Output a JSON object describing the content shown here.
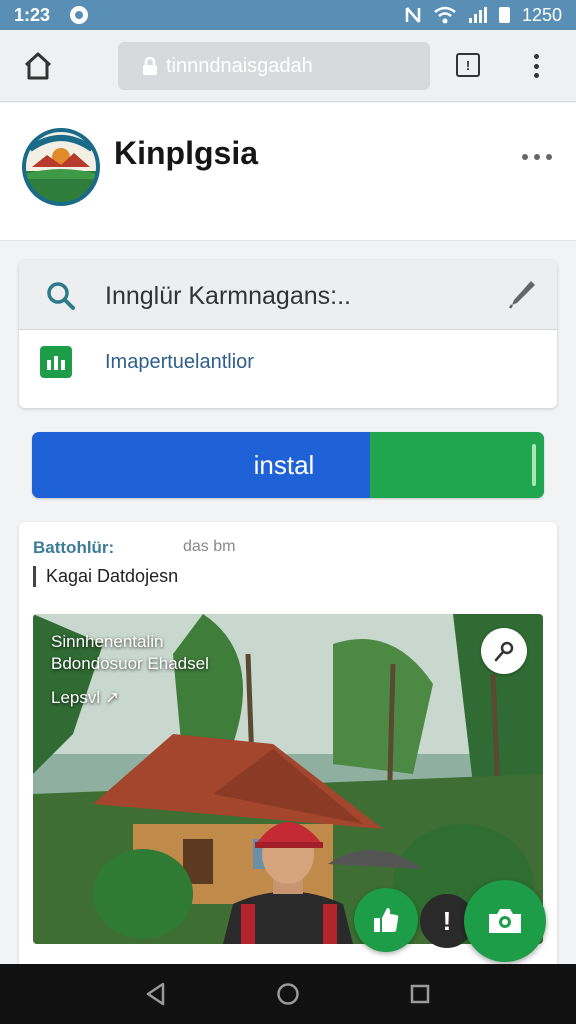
{
  "status_bar": {
    "time": "1:23",
    "right_time": "1250"
  },
  "browser": {
    "url": "tinnndnaisgadah",
    "tabs_count": "!"
  },
  "header": {
    "title": "Kinplgsia"
  },
  "search": {
    "query": "Innglür Karmnagans:..",
    "suggestion": "Imapertuelantlior"
  },
  "install": {
    "label": "instal",
    "progress": 0.34
  },
  "card": {
    "heading": "Battohlür:",
    "meta": "das bm",
    "subtitle": "Kagai Datdojesn",
    "photo_lines": [
      "Sinnhenentalin",
      "Bdondosuor Ehadsel",
      "Lepsvl ↗"
    ]
  },
  "fab": {
    "dark_label": "!"
  },
  "colors": {
    "primary_blue": "#1f61d6",
    "accent_green": "#1e9d48",
    "status_bar": "#5a8fb5"
  }
}
